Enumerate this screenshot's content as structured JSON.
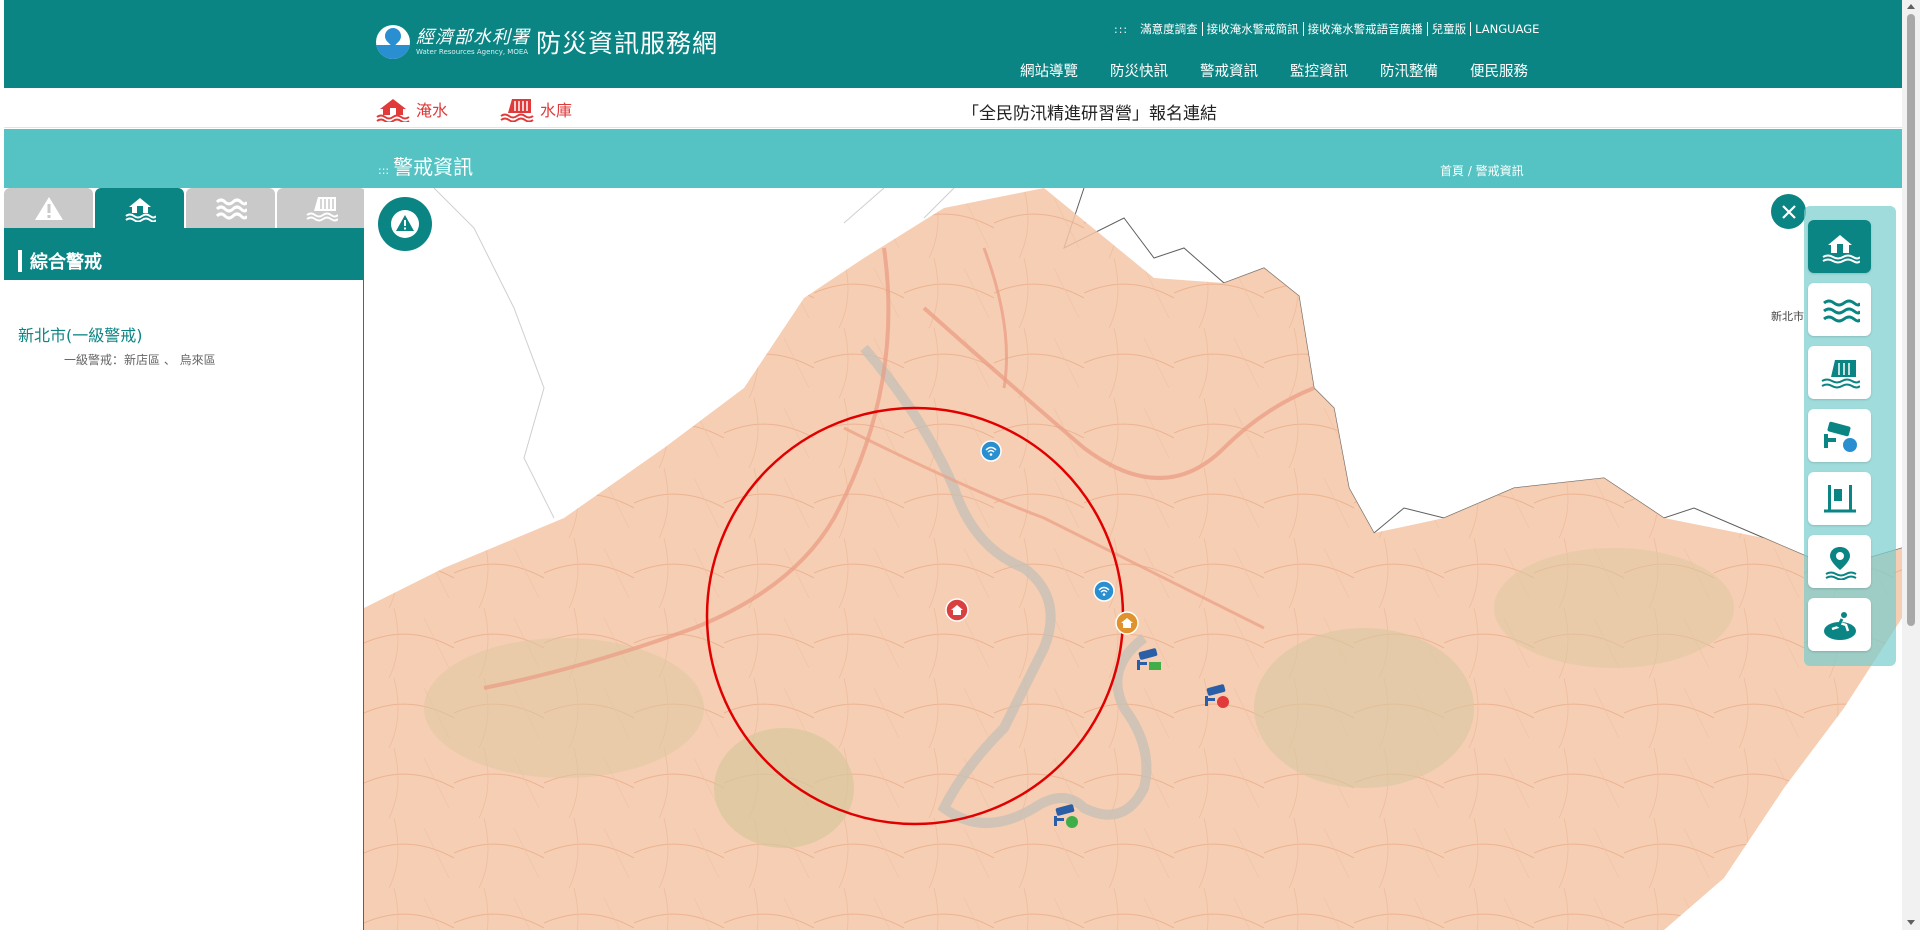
{
  "header": {
    "agency_name": "經濟部水利署",
    "agency_name_en": "Water Resources Agency, MOEA",
    "site_title": "防災資訊服務網",
    "util_dots": ":::",
    "util_links": [
      "滿意度調查",
      "接收淹水警戒簡訊",
      "接收淹水警戒語音廣播",
      "兒童版",
      "LANGUAGE"
    ],
    "nav": [
      "網站導覽",
      "防災快訊",
      "警戒資訊",
      "監控資訊",
      "防汛整備",
      "便民服務"
    ]
  },
  "quick_bar": {
    "links": [
      {
        "label": "淹水",
        "icon": "flood-house-icon"
      },
      {
        "label": "水庫",
        "icon": "reservoir-icon"
      }
    ],
    "announcement": "「全民防汛精進研習營」報名連結"
  },
  "page": {
    "title_dots": ":::",
    "title": "警戒資訊",
    "breadcrumb": "首頁 / 警戒資訊"
  },
  "left_panel": {
    "tabs": [
      {
        "icon": "warning-icon",
        "active": false
      },
      {
        "icon": "flood-house-icon",
        "active": true
      },
      {
        "icon": "water-waves-icon",
        "active": false
      },
      {
        "icon": "reservoir-icon",
        "active": false
      }
    ],
    "summary_title": "綜合警戒",
    "warnings": [
      {
        "city": "新北市(一級警戒)",
        "detail": "一級警戒：新店區 、 烏來區"
      }
    ]
  },
  "map": {
    "city_label": "新北市",
    "alert_radius_color": "#e00000",
    "markers": [
      {
        "type": "wifi-sensor-icon",
        "color": "#2a8fd0"
      },
      {
        "type": "wifi-sensor-icon",
        "color": "#2a8fd0"
      },
      {
        "type": "flood-house-icon",
        "color": "#d94141"
      },
      {
        "type": "flood-house-icon",
        "color": "#e0922d"
      },
      {
        "type": "cctv-camera-icon",
        "color": "#2a5fa8"
      },
      {
        "type": "cctv-camera-icon",
        "color": "#2a5fa8"
      },
      {
        "type": "cctv-camera-icon",
        "color": "#2a5fa8"
      }
    ]
  },
  "tool_panel": {
    "buttons": [
      {
        "icon": "flood-house-icon",
        "active": true
      },
      {
        "icon": "water-waves-icon",
        "active": false
      },
      {
        "icon": "reservoir-icon",
        "active": false
      },
      {
        "icon": "cctv-camera-icon",
        "active": false
      },
      {
        "icon": "water-gauge-icon",
        "active": false
      },
      {
        "icon": "location-water-icon",
        "active": false
      },
      {
        "icon": "evacuation-icon",
        "active": false
      }
    ]
  },
  "colors": {
    "brand": "#0a8584",
    "title_bar": "#55c3c3",
    "alert_red": "#e03a3a",
    "map_tint": "#f4c6a6"
  }
}
